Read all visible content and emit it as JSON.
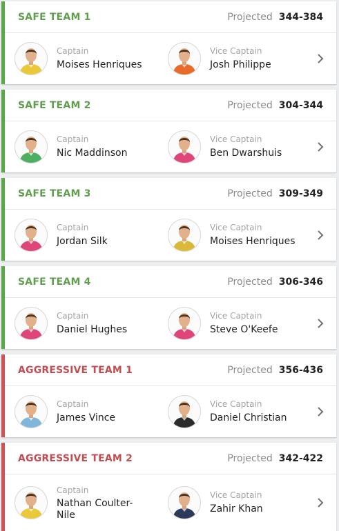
{
  "projected_label": "Projected",
  "captain_label": "Captain",
  "vice_captain_label": "Vice Captain",
  "colors": {
    "safe_accent": "#5aa84a",
    "aggressive_accent": "#cd5456",
    "background": "#eceef0"
  },
  "teams": [
    {
      "name": "SAFE TEAM 1",
      "type": "safe",
      "projected": "344-384",
      "captain": {
        "name": "Moises Henriques",
        "jersey": "#e9c83a"
      },
      "vice_captain": {
        "name": "Josh Philippe",
        "jersey": "#e86b2a"
      }
    },
    {
      "name": "SAFE TEAM 2",
      "type": "safe",
      "projected": "304-344",
      "captain": {
        "name": "Nic Maddinson",
        "jersey": "#4caf62"
      },
      "vice_captain": {
        "name": "Ben Dwarshuis",
        "jersey": "#e0457a"
      }
    },
    {
      "name": "SAFE TEAM 3",
      "type": "safe",
      "projected": "309-349",
      "captain": {
        "name": "Jordan Silk",
        "jersey": "#e0457a"
      },
      "vice_captain": {
        "name": "Moises Henriques",
        "jersey": "#d9b83a"
      }
    },
    {
      "name": "SAFE TEAM 4",
      "type": "safe",
      "projected": "306-346",
      "captain": {
        "name": "Daniel Hughes",
        "jersey": "#e0457a"
      },
      "vice_captain": {
        "name": "Steve O'Keefe",
        "jersey": "#e0457a"
      }
    },
    {
      "name": "AGGRESSIVE TEAM 1",
      "type": "aggressive",
      "projected": "356-436",
      "captain": {
        "name": "James Vince",
        "jersey": "#7fb6d9"
      },
      "vice_captain": {
        "name": "Daniel Christian",
        "jersey": "#2b2b2b"
      }
    },
    {
      "name": "AGGRESSIVE TEAM 2",
      "type": "aggressive",
      "projected": "342-422",
      "captain": {
        "name": "Nathan Coulter-Nile",
        "jersey": "#e9c83a"
      },
      "vice_captain": {
        "name": "Zahir Khan",
        "jersey": "#2e3a5c"
      }
    }
  ]
}
